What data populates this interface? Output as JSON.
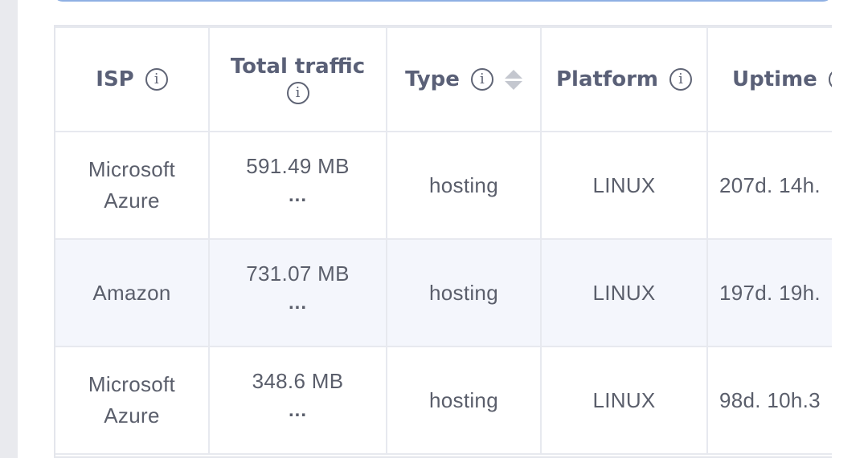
{
  "table": {
    "headers": {
      "isp": "ISP",
      "traffic": "Total traffic",
      "type": "Type",
      "platform": "Platform",
      "uptime": "Uptime"
    },
    "rows": [
      {
        "isp": "Microsoft Azure",
        "traffic": "591.49 MB",
        "more": "...",
        "type": "hosting",
        "platform": "LINUX",
        "uptime": "207d. 14h."
      },
      {
        "isp": "Amazon",
        "traffic": "731.07 MB",
        "more": "...",
        "type": "hosting",
        "platform": "LINUX",
        "uptime": "197d. 19h."
      },
      {
        "isp": "Microsoft Azure",
        "traffic": "348.6 MB",
        "more": "...",
        "type": "hosting",
        "platform": "LINUX",
        "uptime": "98d. 10h.3"
      }
    ],
    "info_icon_glyph": "i",
    "icons": [
      "info-icon",
      "sort-icon"
    ]
  },
  "colors": {
    "header_text": "#5a6077",
    "row_alt_bg": "#f4f6fc",
    "border": "#e7e9ef",
    "search_border": "#8fb0e3"
  }
}
